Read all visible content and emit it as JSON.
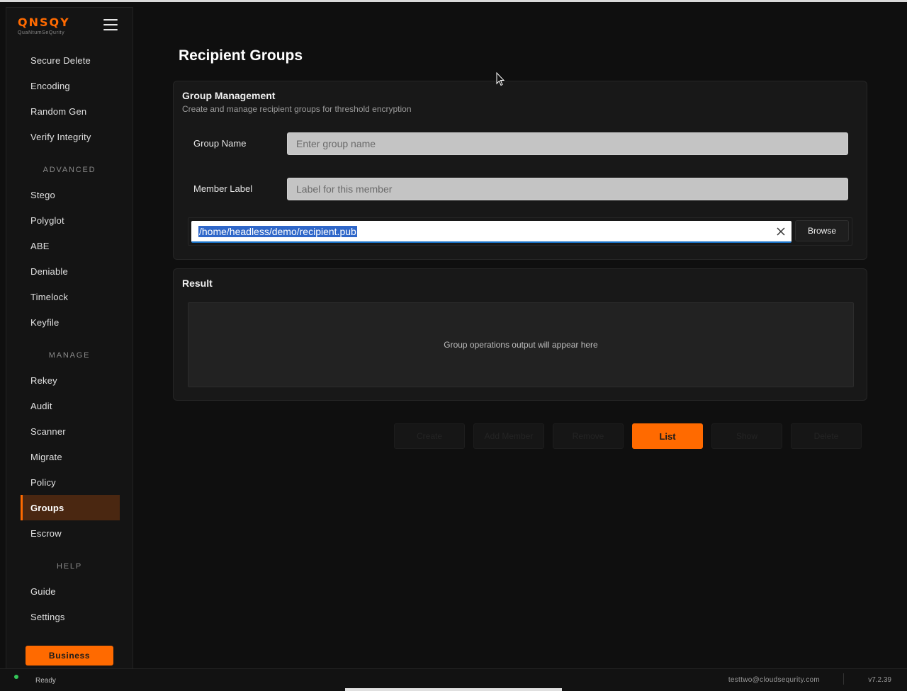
{
  "app": {
    "logo": "QNSQY",
    "tagline": "QuaNtumSeQurity"
  },
  "sidebar": {
    "items_top": [
      {
        "label": "Secure Delete"
      },
      {
        "label": "Encoding"
      },
      {
        "label": "Random Gen"
      },
      {
        "label": "Verify Integrity"
      }
    ],
    "section_advanced": "ADVANCED",
    "items_advanced": [
      {
        "label": "Stego"
      },
      {
        "label": "Polyglot"
      },
      {
        "label": "ABE"
      },
      {
        "label": "Deniable"
      },
      {
        "label": "Timelock"
      },
      {
        "label": "Keyfile"
      }
    ],
    "section_manage": "MANAGE",
    "items_manage": [
      {
        "label": "Rekey"
      },
      {
        "label": "Audit"
      },
      {
        "label": "Scanner"
      },
      {
        "label": "Migrate"
      },
      {
        "label": "Policy"
      },
      {
        "label": "Groups",
        "active": true
      },
      {
        "label": "Escrow"
      }
    ],
    "section_help": "HELP",
    "items_help": [
      {
        "label": "Guide"
      },
      {
        "label": "Settings"
      }
    ],
    "business_label": "Business"
  },
  "page": {
    "title": "Recipient Groups"
  },
  "group_management": {
    "title": "Group Management",
    "subtitle": "Create and manage recipient groups for threshold encryption",
    "group_name_label": "Group Name",
    "group_name_placeholder": "Enter group name",
    "member_label_label": "Member Label",
    "member_label_placeholder": "Label for this member",
    "file_path": "/home/headless/demo/recipient.pub",
    "browse_label": "Browse"
  },
  "result": {
    "title": "Result",
    "placeholder": "Group operations output will appear here"
  },
  "actions": {
    "create": "Create",
    "add_member": "Add Member",
    "remove": "Remove",
    "list": "List",
    "show": "Show",
    "delete": "Delete"
  },
  "status": {
    "text": "Ready",
    "user": "testtwo@cloudsequrity.com",
    "version": "v7.2.39"
  },
  "colors": {
    "accent": "#ff6a00",
    "active_nav_bg": "#4a2711",
    "status_ok": "#34c759"
  }
}
